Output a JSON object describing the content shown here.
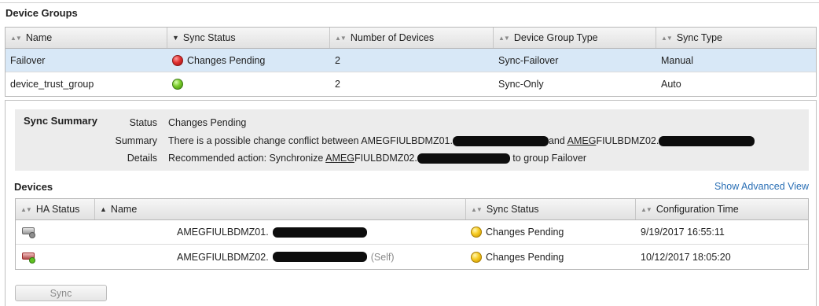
{
  "panel_title": "Device Groups",
  "device_groups": {
    "columns": [
      "Name",
      "Sync Status",
      "Number of Devices",
      "Device Group Type",
      "Sync Type"
    ],
    "rows": [
      {
        "name": "Failover",
        "sync_status": "Changes Pending",
        "status_color": "red",
        "devices": "2",
        "type": "Sync-Failover",
        "sync_type": "Manual",
        "selected": true
      },
      {
        "name": "device_trust_group",
        "sync_status": "",
        "status_color": "green",
        "devices": "2",
        "type": "Sync-Only",
        "sync_type": "Auto",
        "selected": false
      }
    ]
  },
  "sync_summary": {
    "title": "Sync Summary",
    "status_label": "Status",
    "status_value": "Changes Pending",
    "summary_label": "Summary",
    "summary_prefix": "There is a possible change conflict between AMEGFIULBDMZ01.",
    "summary_mid": "and ",
    "summary_host2_ul": "AMEG",
    "summary_host2_rest": "FIULBDMZ02.",
    "details_label": "Details",
    "details_prefix": "Recommended action: Synchronize ",
    "details_host_ul": "AMEG",
    "details_host_rest": "FIULBDMZ02.",
    "details_suffix": " to group Failover"
  },
  "devices": {
    "title": "Devices",
    "advanced_link": "Show Advanced View",
    "columns": [
      "HA Status",
      "Name",
      "Sync Status",
      "Configuration Time"
    ],
    "rows": [
      {
        "name": "AMEGFIULBDMZ01.",
        "self": "",
        "sync_status": "Changes Pending",
        "config_time": "9/19/2017 16:55:11"
      },
      {
        "name": "AMEGFIULBDMZ02.",
        "self": "(Self)",
        "sync_status": "Changes Pending",
        "config_time": "10/12/2017 18:05:20"
      }
    ]
  },
  "sync_button": "Sync",
  "colors": {
    "selected_row": "#d8e8f7",
    "link": "#2a6fb5",
    "summary_bg": "#ececec"
  }
}
